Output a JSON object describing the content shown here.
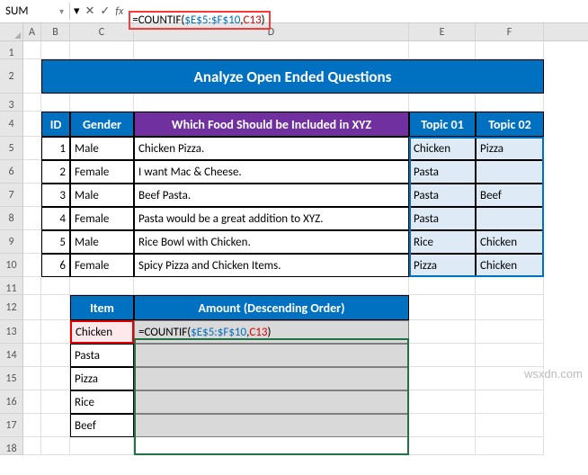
{
  "name_box": "SUM",
  "formula_text": "=COUNTIF($E$5:$F$10,C13)",
  "formula_parts": {
    "eq": "=",
    "fn": "COUNTIF(",
    "r1": "$E$5:$F$10",
    "comma": ",",
    "r2": "C13",
    "close": ")"
  },
  "columns": [
    "A",
    "B",
    "C",
    "D",
    "E",
    "F"
  ],
  "row_numbers": [
    "1",
    "2",
    "3",
    "4",
    "5",
    "6",
    "7",
    "8",
    "9",
    "10",
    "11",
    "12",
    "13",
    "14",
    "15",
    "16",
    "17",
    "18"
  ],
  "title": "Analyze Open Ended Questions",
  "table1": {
    "headers": {
      "id": "ID",
      "gender": "Gender",
      "question": "Which Food Should be Included in XYZ",
      "t1": "Topic 01",
      "t2": "Topic 02"
    },
    "rows": [
      {
        "id": "1",
        "gender": "Male",
        "q": "Chicken Pizza.",
        "t1": "Chicken",
        "t2": "Pizza"
      },
      {
        "id": "2",
        "gender": "Female",
        "q": "I want Mac & Cheese.",
        "t1": "Pasta",
        "t2": ""
      },
      {
        "id": "3",
        "gender": "Male",
        "q": "Beef Pasta.",
        "t1": "Pasta",
        "t2": "Beef"
      },
      {
        "id": "4",
        "gender": "Female",
        "q": "Pasta would be a great addition to XYZ.",
        "t1": "Pasta",
        "t2": ""
      },
      {
        "id": "5",
        "gender": "Male",
        "q": "Rice Bowl with Chicken.",
        "t1": "Rice",
        "t2": "Chicken"
      },
      {
        "id": "6",
        "gender": "Female",
        "q": "Spicy Pizza and Chicken Items.",
        "t1": "Pizza",
        "t2": "Chicken"
      }
    ]
  },
  "table2": {
    "headers": {
      "item": "Item",
      "amount": "Amount (Descending Order)"
    },
    "items": [
      "Chicken",
      "Pasta",
      "Pizza",
      "Rice",
      "Beef"
    ]
  },
  "watermark": "wsxdn.com"
}
